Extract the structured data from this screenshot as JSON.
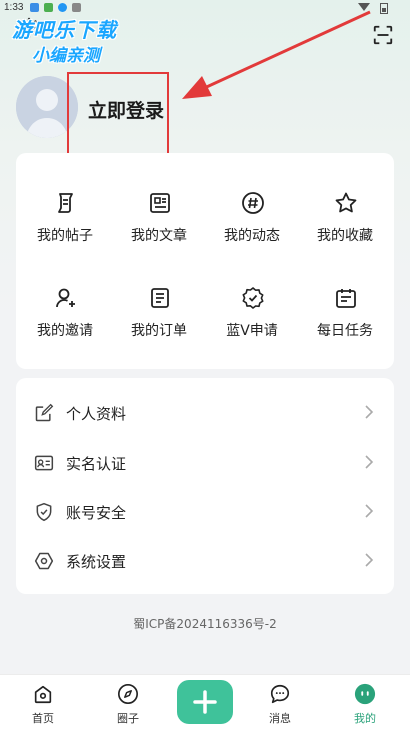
{
  "status_bar": {
    "time": "1:33"
  },
  "watermark": {
    "line1": "游吧乐下载",
    "line2": "小编亲测"
  },
  "profile": {
    "login_label": "立即登录"
  },
  "features": [
    {
      "label": "我的帖子",
      "icon": "post-icon"
    },
    {
      "label": "我的文章",
      "icon": "article-icon"
    },
    {
      "label": "我的动态",
      "icon": "hashtag-icon"
    },
    {
      "label": "我的收藏",
      "icon": "star-icon"
    },
    {
      "label": "我的邀请",
      "icon": "invite-user-icon"
    },
    {
      "label": "我的订单",
      "icon": "order-icon"
    },
    {
      "label": "蓝V申请",
      "icon": "verified-badge-icon"
    },
    {
      "label": "每日任务",
      "icon": "calendar-task-icon"
    }
  ],
  "menu": [
    {
      "label": "个人资料",
      "icon": "edit-profile-icon"
    },
    {
      "label": "实名认证",
      "icon": "id-card-icon"
    },
    {
      "label": "账号安全",
      "icon": "shield-icon"
    },
    {
      "label": "系统设置",
      "icon": "settings-icon"
    }
  ],
  "footer": {
    "icp": "蜀ICP备2024116336号-2"
  },
  "nav": [
    {
      "label": "首页",
      "icon": "home-icon"
    },
    {
      "label": "圈子",
      "icon": "compass-icon"
    },
    {
      "label": "消息",
      "icon": "message-icon"
    },
    {
      "label": "我的",
      "icon": "profile-face-icon",
      "active": true
    }
  ],
  "colors": {
    "accent": "#3fc29a",
    "active_nav": "#2aa27a",
    "annotation": "#e23a3a"
  }
}
